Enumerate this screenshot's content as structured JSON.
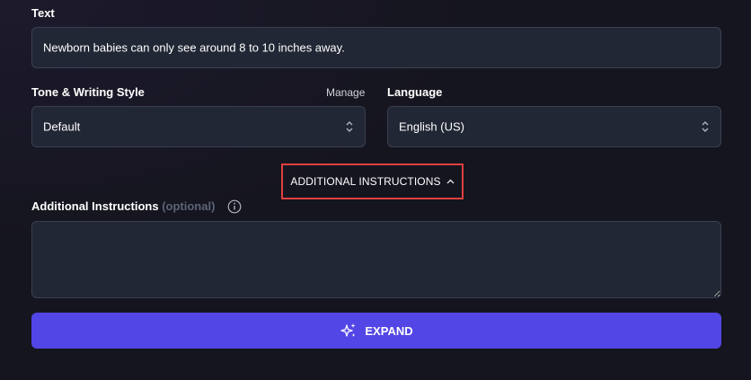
{
  "text_field": {
    "label": "Text",
    "value": "Newborn babies can only see around 8 to 10 inches away."
  },
  "tone": {
    "label": "Tone & Writing Style",
    "manage_label": "Manage",
    "value": "Default"
  },
  "language": {
    "label": "Language",
    "value": "English (US)"
  },
  "additional_toggle": {
    "label": "ADDITIONAL INSTRUCTIONS",
    "icon": "chevron-up-icon"
  },
  "additional_instructions": {
    "label": "Additional Instructions",
    "optional_label": "(optional)",
    "value": "",
    "icon": "info-icon"
  },
  "expand_button": {
    "label": "EXPAND",
    "icon": "sparkles-icon"
  },
  "colors": {
    "background": "#15151f",
    "field_bg": "#222735",
    "accent": "#5346e6",
    "highlight_border": "#e0403f"
  }
}
